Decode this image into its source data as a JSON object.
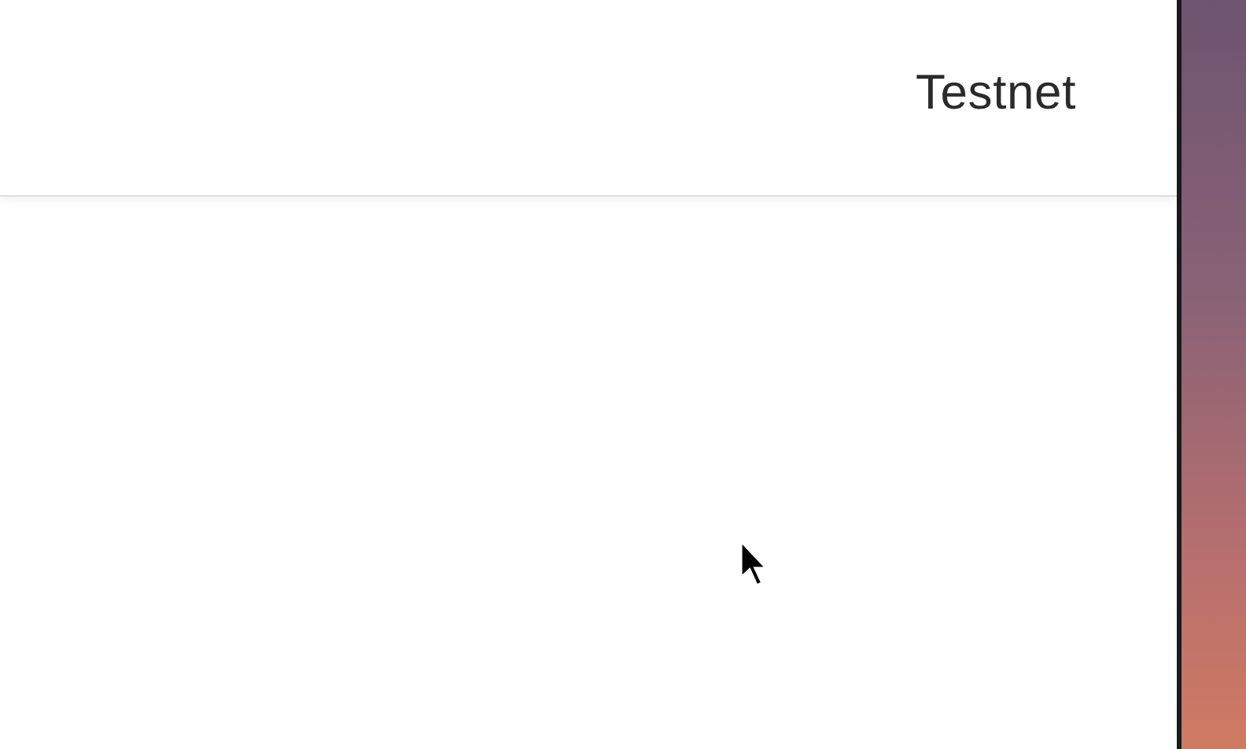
{
  "header": {
    "network_label": "Testnet"
  }
}
